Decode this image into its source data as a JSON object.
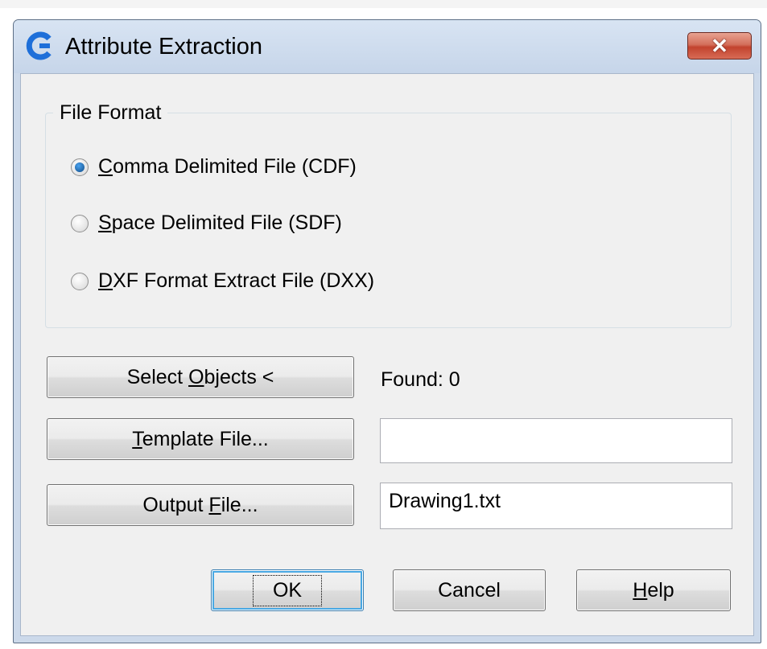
{
  "dialog": {
    "title": "Attribute Extraction",
    "close_symbol": "✕"
  },
  "file_format": {
    "group_label": "File Format",
    "options": [
      {
        "key": "C",
        "rest": "omma Delimited File (CDF)",
        "selected": true
      },
      {
        "key": "S",
        "rest": "pace Delimited File (SDF)",
        "selected": false
      },
      {
        "key": "D",
        "rest": "XF Format Extract File (DXX)",
        "selected": false
      }
    ]
  },
  "select_objects": {
    "pre": "Select ",
    "key": "O",
    "post": "bjects <"
  },
  "found_text": "Found: 0",
  "template_file": {
    "key": "T",
    "post": "emplate File...",
    "value": ""
  },
  "output_file": {
    "pre": "Output ",
    "key": "F",
    "post": "ile...",
    "value": "Drawing1.txt"
  },
  "buttons": {
    "ok": "OK",
    "cancel": "Cancel",
    "help_key": "H",
    "help_post": "elp"
  },
  "colors": {
    "frame": "#ccd9ea",
    "close_button": "#c7432e",
    "app_icon": "#1e6fd9",
    "default_button_border": "#48a8e3"
  }
}
